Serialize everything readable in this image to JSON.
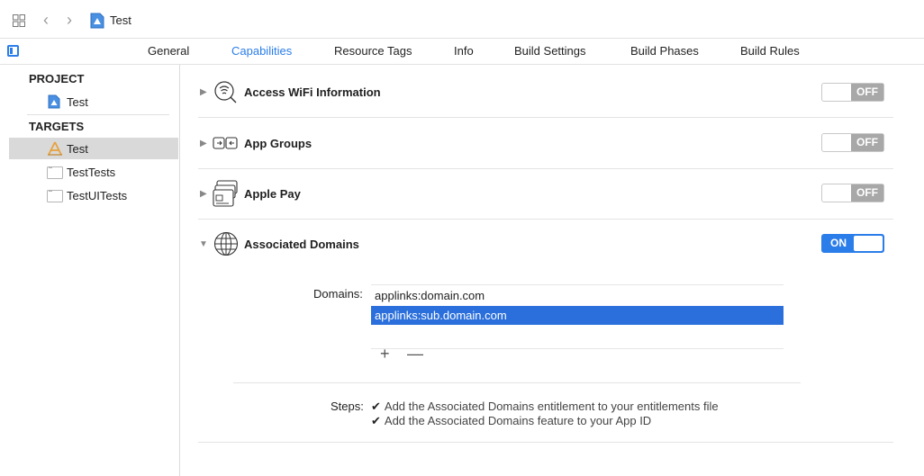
{
  "header": {
    "breadcrumb": "Test"
  },
  "tabs": [
    {
      "label": "General"
    },
    {
      "label": "Capabilities",
      "active": true
    },
    {
      "label": "Resource Tags"
    },
    {
      "label": "Info"
    },
    {
      "label": "Build Settings"
    },
    {
      "label": "Build Phases"
    },
    {
      "label": "Build Rules"
    }
  ],
  "sidebar": {
    "project_header": "PROJECT",
    "project_item": "Test",
    "targets_header": "TARGETS",
    "targets": [
      {
        "label": "Test",
        "selected": true
      },
      {
        "label": "TestTests"
      },
      {
        "label": "TestUITests"
      }
    ]
  },
  "capabilities": [
    {
      "title": "Access WiFi Information",
      "icon": "wifi-info-icon",
      "state": "OFF",
      "expanded": false
    },
    {
      "title": "App Groups",
      "icon": "app-groups-icon",
      "state": "OFF",
      "expanded": false
    },
    {
      "title": "Apple Pay",
      "icon": "apple-pay-icon",
      "state": "OFF",
      "expanded": false
    },
    {
      "title": "Associated Domains",
      "icon": "globe-icon",
      "state": "ON",
      "expanded": true
    }
  ],
  "associated_domains": {
    "domains_label": "Domains:",
    "domains": [
      "applinks:domain.com",
      "applinks:sub.domain.com"
    ],
    "selected_index": 1,
    "add_symbol": "+",
    "remove_symbol": "—",
    "steps_label": "Steps:",
    "check_symbol": "✔",
    "steps": [
      "Add the Associated Domains entitlement to your entitlements file",
      "Add the Associated Domains feature to your App ID"
    ]
  },
  "colors": {
    "accent": "#2b7de9",
    "selection": "#2a6fdb",
    "toggle_off": "#a8a8a8"
  }
}
